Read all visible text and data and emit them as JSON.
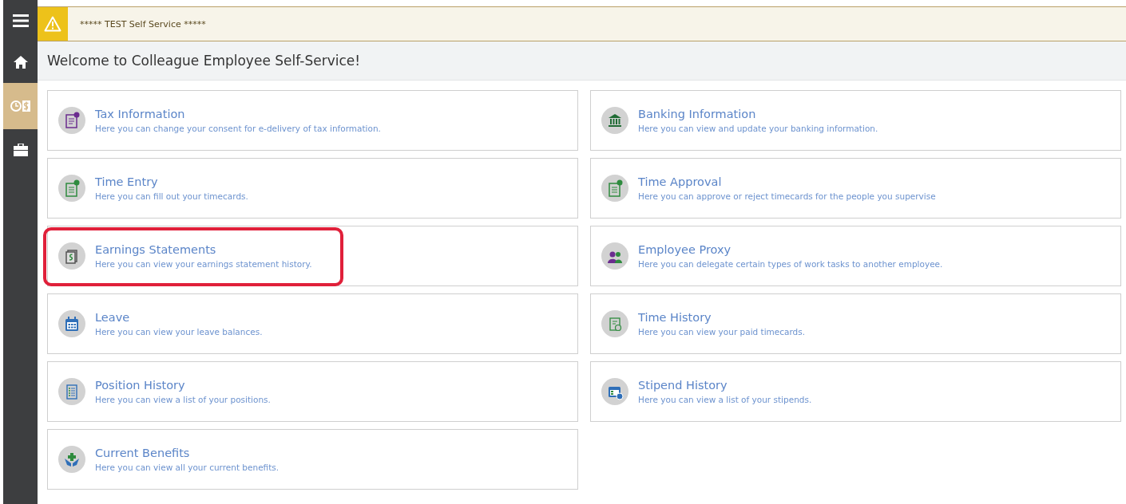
{
  "sidebar": {
    "items": [
      {
        "kind": "menu",
        "selected": false
      },
      {
        "kind": "home",
        "selected": false
      },
      {
        "kind": "timepay",
        "selected": true
      },
      {
        "kind": "briefcase",
        "selected": false
      }
    ]
  },
  "banner": {
    "text": "***** TEST Self Service *****"
  },
  "heading": "Welcome to Colleague Employee Self-Service!",
  "tiles": [
    {
      "title": "Tax Information",
      "description": "Here you can change your consent for e-delivery of tax information.",
      "kind": "tax",
      "highlighted": false
    },
    {
      "title": "Banking Information",
      "description": "Here you can view and update your banking information.",
      "kind": "bank",
      "highlighted": false
    },
    {
      "title": "Time Entry",
      "description": "Here you can fill out your timecards.",
      "kind": "timecard",
      "highlighted": false
    },
    {
      "title": "Time Approval",
      "description": "Here you can approve or reject timecards for the people you supervise",
      "kind": "timecard",
      "highlighted": false
    },
    {
      "title": "Earnings Statements",
      "description": "Here you can view your earnings statement history.",
      "kind": "earnings",
      "highlighted": true
    },
    {
      "title": "Employee Proxy",
      "description": "Here you can delegate certain types of work tasks to another employee.",
      "kind": "people",
      "highlighted": false
    },
    {
      "title": "Leave",
      "description": "Here you can view your leave balances.",
      "kind": "calendar",
      "highlighted": false
    },
    {
      "title": "Time History",
      "description": "Here you can view your paid timecards.",
      "kind": "history",
      "highlighted": false
    },
    {
      "title": "Position History",
      "description": "Here you can view a list of your positions.",
      "kind": "list",
      "highlighted": false
    },
    {
      "title": "Stipend History",
      "description": "Here you can view a list of your stipends.",
      "kind": "stipend",
      "highlighted": false
    },
    {
      "title": "Current Benefits",
      "description": "Here you can view all your current benefits.",
      "kind": "benefits",
      "highlighted": false
    }
  ]
}
